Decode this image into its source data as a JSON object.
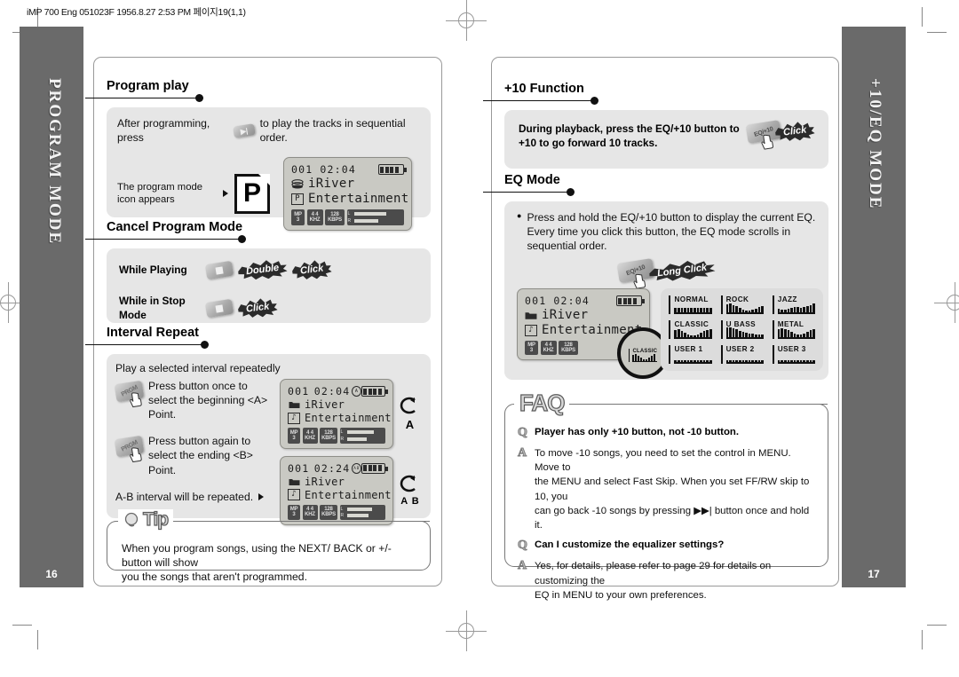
{
  "print": {
    "header": "iMP 700 Eng 051023F  1956.8.27 2:53 PM  페이지19(1,1)"
  },
  "sidebars": {
    "left": {
      "label": "PROGRAM MODE",
      "page_number": "16"
    },
    "right": {
      "label": "+10/EQ MODE",
      "page_number": "17"
    }
  },
  "left_page": {
    "program_play": {
      "heading": "Program play",
      "intro_before": "After programming, press",
      "intro_after": "to play the tracks in sequential order.",
      "callout_line1": "The program mode",
      "callout_line2": "icon appears",
      "program_icon_letter": "P",
      "lcd": {
        "track": "001",
        "time": "02:04",
        "folder": "iRiver",
        "title": "Entertainment",
        "tags": [
          "MP3",
          "44KHZ",
          "128KBPS"
        ],
        "channel_left": "L",
        "channel_right": "R"
      }
    },
    "cancel_program_mode": {
      "heading": "Cancel Program Mode",
      "rows": [
        {
          "label": "While Playing",
          "button": "",
          "action1": "Double",
          "action2": "Click"
        },
        {
          "label": "While in Stop Mode",
          "button": "",
          "action1": "Click",
          "action2": ""
        }
      ]
    },
    "interval_repeat": {
      "heading": "Interval Repeat",
      "subtitle": "Play a selected interval repeatedly",
      "steps": [
        {
          "button": "PRGM",
          "line1": "Press button once to",
          "line2": "select the beginning <A>",
          "line3": "Point."
        },
        {
          "button": "PRGM",
          "line1": "Press button again to",
          "line2": "select the ending <B>",
          "line3": "Point."
        }
      ],
      "footer": "A-B interval will be repeated.",
      "lcd_a": {
        "track": "001",
        "time": "02:04",
        "folder": "iRiver",
        "title": "Entertainment",
        "tags": [
          "MP3",
          "44KHZ",
          "128KBPS"
        ],
        "repeat_badge": "A"
      },
      "lcd_b": {
        "track": "001",
        "time": "02:24",
        "folder": "iRiver",
        "title": "Entertainment",
        "tags": [
          "MP3",
          "44KHZ",
          "128KBPS"
        ],
        "repeat_badge": "A-B"
      },
      "symbol_a": "A",
      "symbol_ab": "A   B"
    },
    "tip": {
      "badge": "Tip",
      "line1": "When you program songs, using the NEXT/ BACK or +/- button will show",
      "line2": "you the songs that aren't programmed."
    }
  },
  "right_page": {
    "plus10_function": {
      "heading": "+10 Function",
      "line1": "During playback, press the EQ/+10 button to",
      "line2": "+10 to go forward 10 tracks.",
      "button": "EQ/+10",
      "action": "Click"
    },
    "eq_mode": {
      "heading": "EQ Mode",
      "bullet_line1": "Press and hold the EQ/+10 button to display the current EQ.",
      "bullet_line2": "Every time you click this button, the EQ mode scrolls in sequential order.",
      "button": "EQ/+10",
      "action": "Long Click",
      "lcd": {
        "track": "001",
        "time": "02:04",
        "folder": "iRiver",
        "title": "Entertainment",
        "tags": [
          "MP3",
          "44KHZ",
          "128KBPS"
        ],
        "eq_current": "CLASSIC"
      },
      "presets": [
        {
          "name": "NORMAL",
          "bars": [
            5,
            5,
            5,
            5,
            5,
            5,
            5,
            5,
            5,
            5,
            5,
            5
          ]
        },
        {
          "name": "ROCK",
          "bars": [
            9,
            10,
            8,
            7,
            5,
            3,
            2,
            2,
            3,
            4,
            6,
            7
          ]
        },
        {
          "name": "JAZZ",
          "bars": [
            4,
            3,
            3,
            4,
            5,
            6,
            6,
            5,
            6,
            7,
            8,
            10
          ]
        },
        {
          "name": "CLASSIC",
          "bars": [
            8,
            9,
            7,
            5,
            3,
            2,
            2,
            3,
            5,
            7,
            8,
            9
          ]
        },
        {
          "name": "U BASS",
          "bars": [
            11,
            11,
            10,
            9,
            7,
            6,
            5,
            4,
            4,
            3,
            3,
            3
          ]
        },
        {
          "name": "METAL",
          "bars": [
            9,
            10,
            9,
            8,
            6,
            4,
            3,
            3,
            4,
            6,
            8,
            9
          ]
        },
        {
          "name": "USER 1",
          "bars": [
            2,
            2,
            2,
            2,
            2,
            2,
            2,
            2,
            2,
            2,
            2,
            2
          ]
        },
        {
          "name": "USER 2",
          "bars": [
            2,
            2,
            2,
            2,
            2,
            2,
            2,
            2,
            2,
            2,
            2,
            2
          ]
        },
        {
          "name": "USER 3",
          "bars": [
            2,
            2,
            2,
            2,
            2,
            2,
            2,
            2,
            2,
            2,
            2,
            2
          ]
        }
      ]
    },
    "faq": {
      "badge": "FAQ",
      "items": [
        {
          "q_mark": "Q",
          "question": "Player has only +10 button, not -10 button.",
          "a_mark": "A",
          "answer_line1": "To move -10 songs, you need to set the control in MENU. Move to",
          "answer_line2": "the MENU and select Fast Skip. When you set FF/RW skip to 10, you",
          "answer_line3": "can go back -10 songs by pressing ▶▶| button once and hold it."
        },
        {
          "q_mark": "Q",
          "question": "Can I customize the equalizer settings?",
          "a_mark": "A",
          "answer_line1": "Yes, for details, please refer to page 29 for details on customizing the",
          "answer_line2": "EQ in MENU to your own preferences.",
          "answer_line3": ""
        }
      ]
    }
  },
  "colors": {
    "sidebar_gray": "#6a6a6a",
    "panel_gray": "#e6e6e6",
    "lcd_gray": "#c9c9c3",
    "ink": "#111111"
  }
}
